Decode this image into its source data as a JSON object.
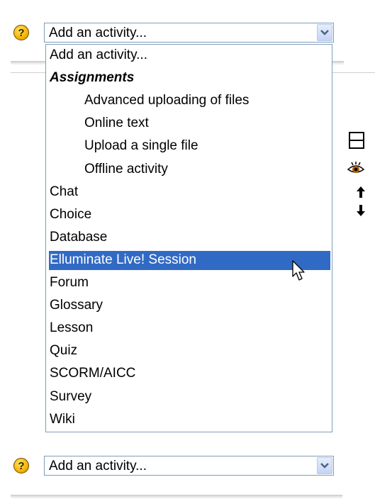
{
  "top_selector": {
    "help_glyph": "?",
    "value": "Add an activity..."
  },
  "dropdown": {
    "options": [
      {
        "label": "Add an activity...",
        "kind": "option",
        "indent": false,
        "selected": false
      },
      {
        "label": "Assignments",
        "kind": "group",
        "indent": false,
        "selected": false
      },
      {
        "label": "Advanced uploading of files",
        "kind": "option",
        "indent": true,
        "selected": false
      },
      {
        "label": "Online text",
        "kind": "option",
        "indent": true,
        "selected": false
      },
      {
        "label": "Upload a single file",
        "kind": "option",
        "indent": true,
        "selected": false
      },
      {
        "label": "Offline activity",
        "kind": "option",
        "indent": true,
        "selected": false
      },
      {
        "label": "Chat",
        "kind": "option",
        "indent": false,
        "selected": false
      },
      {
        "label": "Choice",
        "kind": "option",
        "indent": false,
        "selected": false
      },
      {
        "label": "Database",
        "kind": "option",
        "indent": false,
        "selected": false
      },
      {
        "label": "Elluminate Live! Session",
        "kind": "option",
        "indent": false,
        "selected": true
      },
      {
        "label": "Forum",
        "kind": "option",
        "indent": false,
        "selected": false
      },
      {
        "label": "Glossary",
        "kind": "option",
        "indent": false,
        "selected": false
      },
      {
        "label": "Lesson",
        "kind": "option",
        "indent": false,
        "selected": false
      },
      {
        "label": "Quiz",
        "kind": "option",
        "indent": false,
        "selected": false
      },
      {
        "label": "SCORM/AICC",
        "kind": "option",
        "indent": false,
        "selected": false
      },
      {
        "label": "Survey",
        "kind": "option",
        "indent": false,
        "selected": false
      },
      {
        "label": "Wiki",
        "kind": "option",
        "indent": false,
        "selected": false
      }
    ]
  },
  "bottom_selector": {
    "help_glyph": "?",
    "value": "Add an activity..."
  },
  "side_icons": [
    "split-section-icon",
    "eye-icon",
    "move-up-icon",
    "move-down-icon"
  ],
  "colors": {
    "selection_bg": "#316ac5",
    "selection_text": "#ffffff",
    "border": "#7f9db9",
    "help_icon": "#f5b400"
  }
}
